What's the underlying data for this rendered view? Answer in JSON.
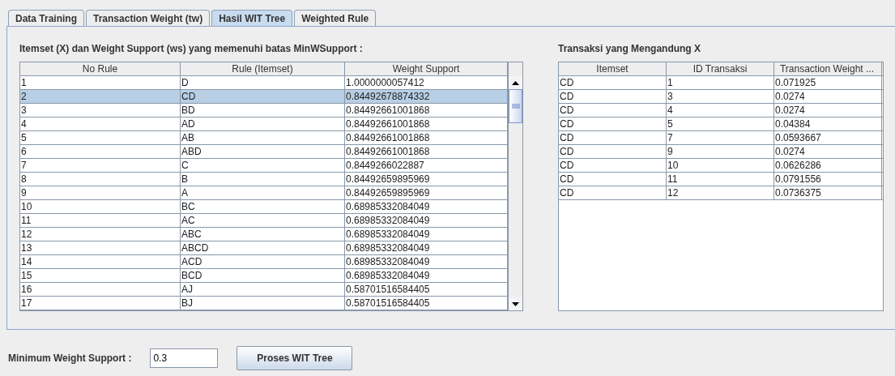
{
  "tabs": [
    {
      "label": "Data Training",
      "selected": false
    },
    {
      "label": "Transaction Weight (tw)",
      "selected": false
    },
    {
      "label": "Hasil WIT Tree",
      "selected": true
    },
    {
      "label": "Weighted Rule",
      "selected": false
    }
  ],
  "rules_panel": {
    "title": "Itemset (X) dan Weight Support (ws) yang memenuhi batas MinWSupport :",
    "table": {
      "columns": [
        "No Rule",
        "Rule (Itemset)",
        "Weight Support"
      ],
      "rows": [
        {
          "cells": [
            "1",
            "D",
            "1.0000000057412"
          ],
          "selected": false
        },
        {
          "cells": [
            "2",
            "CD",
            "0.84492678874332"
          ],
          "selected": true
        },
        {
          "cells": [
            "3",
            "BD",
            "0.84492661001868"
          ],
          "selected": false
        },
        {
          "cells": [
            "4",
            "AD",
            "0.84492661001868"
          ],
          "selected": false
        },
        {
          "cells": [
            "5",
            "AB",
            "0.84492661001868"
          ],
          "selected": false
        },
        {
          "cells": [
            "6",
            "ABD",
            "0.84492661001868"
          ],
          "selected": false
        },
        {
          "cells": [
            "7",
            "C",
            "0.8449266022887"
          ],
          "selected": false
        },
        {
          "cells": [
            "8",
            "B",
            "0.84492659895969"
          ],
          "selected": false
        },
        {
          "cells": [
            "9",
            "A",
            "0.84492659895969"
          ],
          "selected": false
        },
        {
          "cells": [
            "10",
            "BC",
            "0.68985332084049"
          ],
          "selected": false
        },
        {
          "cells": [
            "11",
            "AC",
            "0.68985332084049"
          ],
          "selected": false
        },
        {
          "cells": [
            "12",
            "ABC",
            "0.68985332084049"
          ],
          "selected": false
        },
        {
          "cells": [
            "13",
            "ABCD",
            "0.68985332084049"
          ],
          "selected": false
        },
        {
          "cells": [
            "14",
            "ACD",
            "0.68985332084049"
          ],
          "selected": false
        },
        {
          "cells": [
            "15",
            "BCD",
            "0.68985332084049"
          ],
          "selected": false
        },
        {
          "cells": [
            "16",
            "AJ",
            "0.58701516584405"
          ],
          "selected": false
        },
        {
          "cells": [
            "17",
            "BJ",
            "0.58701516584405"
          ],
          "selected": false
        }
      ]
    }
  },
  "transactions_panel": {
    "title": "Transaksi yang Mengandung X",
    "table": {
      "columns": [
        "Itemset",
        "ID Transaksi",
        "Transaction Weight ..."
      ],
      "rows": [
        {
          "cells": [
            "CD",
            "1",
            "0.071925"
          ]
        },
        {
          "cells": [
            "CD",
            "3",
            "0.0274"
          ]
        },
        {
          "cells": [
            "CD",
            "4",
            "0.0274"
          ]
        },
        {
          "cells": [
            "CD",
            "5",
            "0.04384"
          ]
        },
        {
          "cells": [
            "CD",
            "7",
            "0.0593667"
          ]
        },
        {
          "cells": [
            "CD",
            "9",
            "0.0274"
          ]
        },
        {
          "cells": [
            "CD",
            "10",
            "0.0626286"
          ]
        },
        {
          "cells": [
            "CD",
            "11",
            "0.0791556"
          ]
        },
        {
          "cells": [
            "CD",
            "12",
            "0.0736375"
          ]
        }
      ]
    }
  },
  "min_weight_support": {
    "label": "Minimum Weight Support :",
    "value": "0.3"
  },
  "buttons": [
    "Proses WIT Tree"
  ]
}
